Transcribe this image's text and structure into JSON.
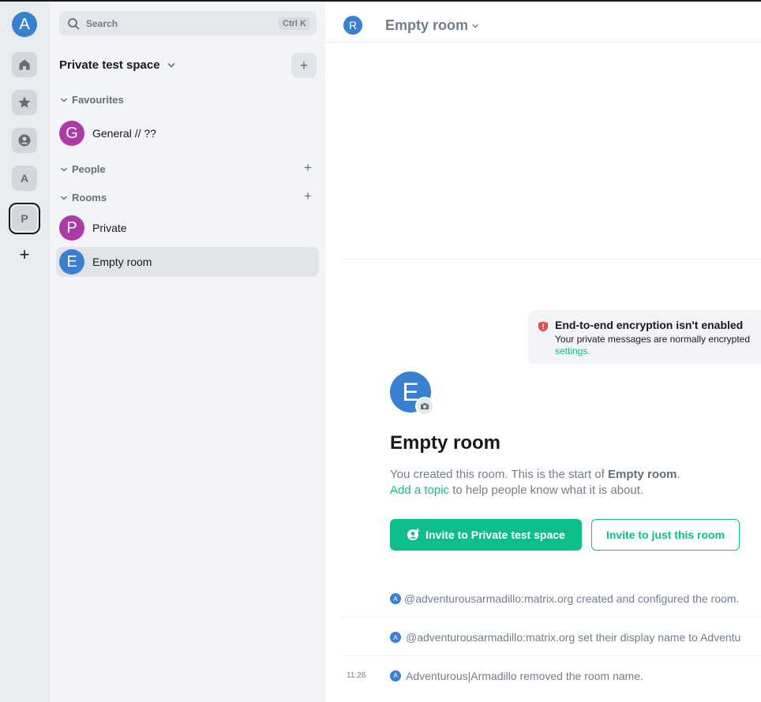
{
  "spacebar": {
    "user_initial": "A",
    "items": [
      {
        "name": "home-icon"
      },
      {
        "name": "star-icon"
      },
      {
        "name": "person-icon"
      },
      {
        "initial": "A"
      },
      {
        "initial": "P"
      }
    ],
    "add_label": "+"
  },
  "roomlist": {
    "search_placeholder": "Search",
    "search_shortcut": "Ctrl K",
    "space_title": "Private test space",
    "space_add": "+",
    "sections": {
      "favourites": "Favourites",
      "people": "People",
      "rooms": "Rooms"
    },
    "favourites": [
      {
        "initial": "G",
        "name": "General // ??",
        "color": "#ac3ba8"
      }
    ],
    "rooms": [
      {
        "initial": "P",
        "name": "Private",
        "color": "#ac3ba8"
      },
      {
        "initial": "E",
        "name": "Empty room",
        "color": "#3a80d0",
        "active": true
      }
    ]
  },
  "header": {
    "avatar_initial": "R",
    "title": "Empty room"
  },
  "e2e": {
    "title": "End-to-end encryption isn't enabled",
    "description": "Your private messages are normally encrypted",
    "link": "settings."
  },
  "intro": {
    "avatar_initial": "E",
    "heading": "Empty room",
    "line1_prefix": "You created this room. This is the start of ",
    "line1_room": "Empty room",
    "line1_suffix": ".",
    "add_topic": "Add a topic",
    "line2_suffix": " to help people know what it is about."
  },
  "buttons": {
    "invite_space": "Invite to Private test space",
    "invite_room": "Invite to just this room"
  },
  "events": [
    {
      "time": "",
      "avatar": "A",
      "text": "@adventurousarmadillo:matrix.org created and configured the room."
    },
    {
      "time": "",
      "avatar": "A",
      "text": "@adventurousarmadillo:matrix.org set their display name to Adventu"
    },
    {
      "time": "11:28",
      "avatar": "A",
      "text": "Adventurous|Armadillo removed the room name."
    }
  ],
  "colors": {
    "accent": "#0dbd8b",
    "avatar_blue": "#3a80d0",
    "avatar_purple": "#ac3ba8",
    "warning_red": "#e5484d"
  }
}
